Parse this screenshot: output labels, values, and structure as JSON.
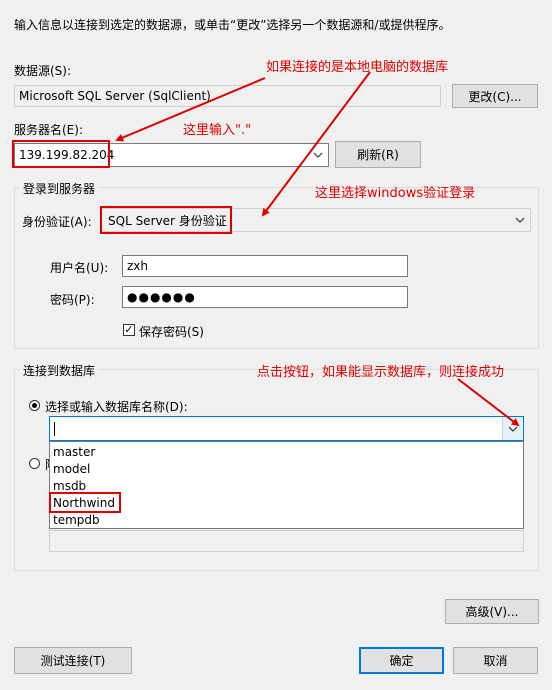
{
  "dialog": {
    "instruction": "输入信息以连接到选定的数据源，或单击“更改”选择另一个数据源和/或提供程序。"
  },
  "data_source": {
    "label": "数据源(S):",
    "value": "Microsoft SQL Server (SqlClient)",
    "change_button": "更改(C)..."
  },
  "server": {
    "label": "服务器名(E):",
    "value": "139.199.82.204",
    "refresh_button": "刷新(R)"
  },
  "login": {
    "group_title": "登录到服务器",
    "auth_label": "身份验证(A):",
    "auth_value": "SQL Server 身份验证",
    "username_label": "用户名(U):",
    "username_value": "zxh",
    "password_label": "密码(P):",
    "password_value": "●●●●●●",
    "save_password_label": "保存密码(S)",
    "save_password_checked": true
  },
  "database": {
    "group_title": "连接到数据库",
    "select_option_label": "选择或输入数据库名称(D):",
    "attach_option_label": "附",
    "dropdown_items": [
      "master",
      "model",
      "msdb",
      "Northwind",
      "tempdb"
    ]
  },
  "buttons": {
    "advanced": "高级(V)...",
    "test": "测试连接(T)",
    "ok": "确定",
    "cancel": "取消"
  },
  "annotations": {
    "local_pc": "如果连接的是本地电脑的数据库",
    "enter_dot": "这里输入\".\"",
    "windows_auth": "这里选择windows验证登录",
    "click_button": "点击按钮，如果能显示数据库，则连接成功"
  },
  "colors": {
    "annotation_red": "#e00000",
    "focus_blue": "#0078d7"
  }
}
